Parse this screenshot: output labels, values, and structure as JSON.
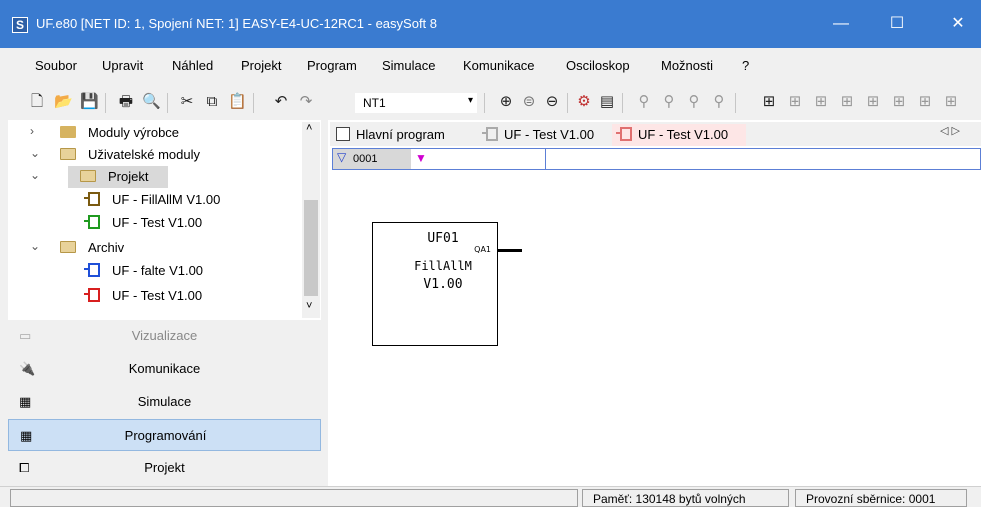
{
  "window": {
    "title": "UF.e80 [NET ID: 1, Spojení NET: 1] EASY-E4-UC-12RC1 - easySoft 8",
    "minimize_glyph": "—",
    "maximize_glyph": "☐",
    "close_glyph": "✕",
    "app_icon_glyph": "S"
  },
  "menu": {
    "items": [
      "Soubor",
      "Upravit",
      "Náhled",
      "Projekt",
      "Program",
      "Simulace",
      "Komunikace",
      "Osciloskop",
      "Možnosti",
      "?"
    ]
  },
  "toolbar": {
    "net_select_value": "NT1",
    "dropdown_arrow": "▾"
  },
  "tree": {
    "items": [
      {
        "label": "Moduly výrobce",
        "expander": "›"
      },
      {
        "label": "Uživatelské moduly",
        "expander": "⌄"
      },
      {
        "label": "Projekt",
        "expander": "⌄"
      },
      {
        "label": "UF - FillAllM V1.00"
      },
      {
        "label": "UF - Test V1.00"
      },
      {
        "label": "Archiv",
        "expander": "⌄"
      },
      {
        "label": "UF - falte V1.00"
      },
      {
        "label": "UF - Test V1.00"
      }
    ],
    "scroll_up": "˄",
    "scroll_down": "˅",
    "colors": {
      "green": "#1f9a1f",
      "blue": "#1f4fd8",
      "red": "#d81f1f",
      "brown": "#7a5a10"
    }
  },
  "nav": {
    "items": [
      {
        "label": "Vizualizace",
        "icon": "visualization-icon"
      },
      {
        "label": "Komunikace",
        "icon": "plug-icon"
      },
      {
        "label": "Simulace",
        "icon": "simulation-icon"
      },
      {
        "label": "Programování",
        "icon": "programming-icon"
      },
      {
        "label": "Projekt",
        "icon": "project-icon"
      }
    ]
  },
  "editor": {
    "tabs": [
      {
        "label": "Hlavní program"
      },
      {
        "label": "UF - Test V1.00"
      },
      {
        "label": "UF - Test V1.00"
      }
    ],
    "tab_nav_glyph": "◁  ▷",
    "rung": {
      "number": "0001",
      "marker": "▼",
      "indicator": "▽"
    },
    "function_block": {
      "name": "UF01",
      "type": "FillAllM",
      "version": "V1.00",
      "output_pin": "QA1"
    }
  },
  "status": {
    "memory": "Paměť: 130148 bytů volných",
    "bus": "Provozní sběrnice: 0001"
  }
}
